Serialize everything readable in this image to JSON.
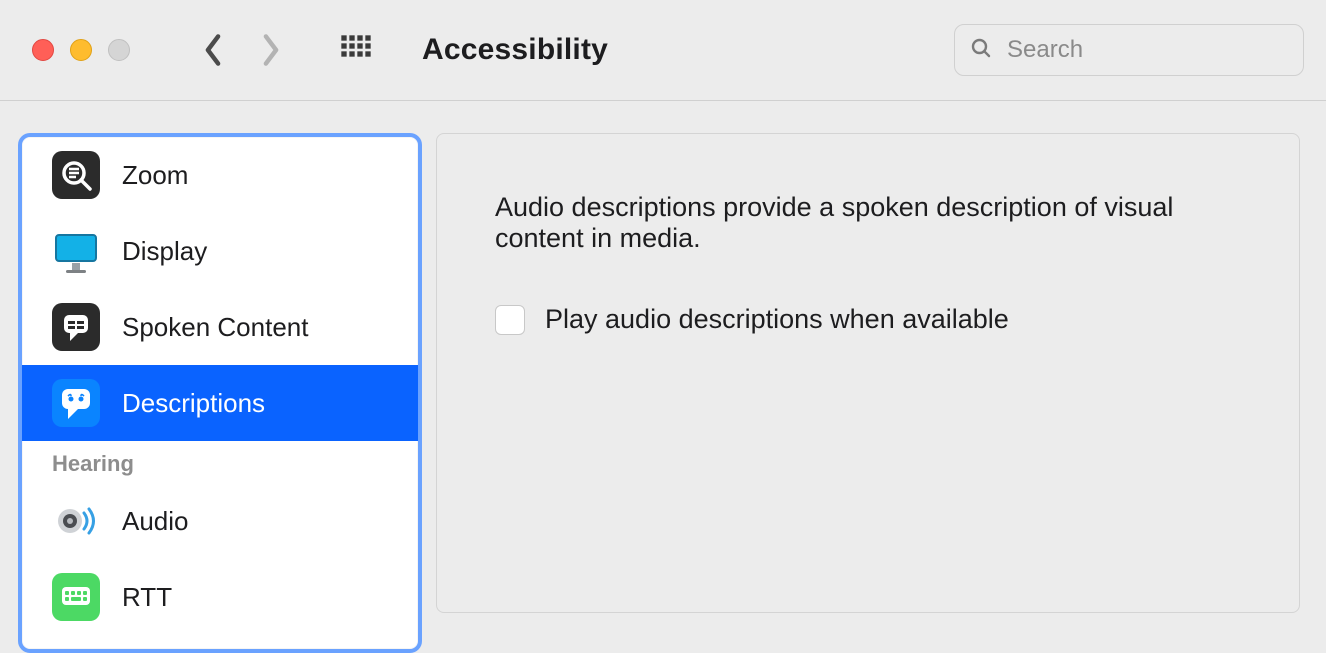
{
  "window": {
    "title": "Accessibility"
  },
  "search": {
    "placeholder": "Search"
  },
  "sidebar": {
    "items": [
      {
        "label": "Zoom",
        "icon": "zoom-icon",
        "selected": false,
        "type": "item"
      },
      {
        "label": "Display",
        "icon": "display-icon",
        "selected": false,
        "type": "item"
      },
      {
        "label": "Spoken Content",
        "icon": "spoken-icon",
        "selected": false,
        "type": "item"
      },
      {
        "label": "Descriptions",
        "icon": "descriptions-icon",
        "selected": true,
        "type": "item"
      },
      {
        "label": "Hearing",
        "type": "section"
      },
      {
        "label": "Audio",
        "icon": "audio-icon",
        "selected": false,
        "type": "item"
      },
      {
        "label": "RTT",
        "icon": "rtt-icon",
        "selected": false,
        "type": "item"
      }
    ]
  },
  "content": {
    "description": "Audio descriptions provide a spoken description of visual content in media.",
    "checkbox_label": "Play audio descriptions when available",
    "checkbox_checked": false
  }
}
